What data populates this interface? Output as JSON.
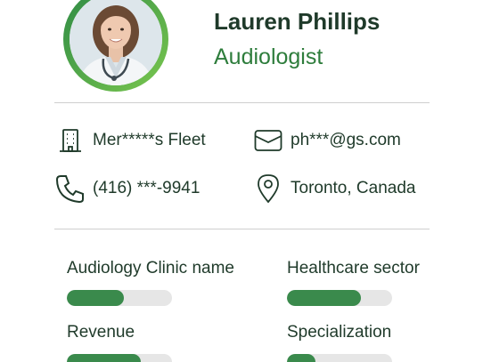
{
  "profile": {
    "name": "Lauren Phillips",
    "title": "Audiologist",
    "avatar_icon": "portrait-photo"
  },
  "contact": {
    "company": {
      "icon": "building-icon",
      "text": "Mer*****s Fleet"
    },
    "email": {
      "icon": "envelope-icon",
      "text": "ph***@gs.com"
    },
    "phone": {
      "icon": "phone-icon",
      "text": "(416) ***-9941"
    },
    "location": {
      "icon": "map-pin-icon",
      "text": "Toronto, Canada"
    }
  },
  "metrics": [
    {
      "label": "Audiology Clinic name",
      "level": 0.54
    },
    {
      "label": "Healthcare sector",
      "level": 0.7
    },
    {
      "label": "Revenue",
      "level": 0.7
    },
    {
      "label": "Specialization",
      "level": 0.27
    }
  ],
  "colors": {
    "accent": "#2e7d3c",
    "bar_fill": "#3a8a4c",
    "bar_track": "#e6e6e6",
    "text": "#1f3a2a"
  }
}
